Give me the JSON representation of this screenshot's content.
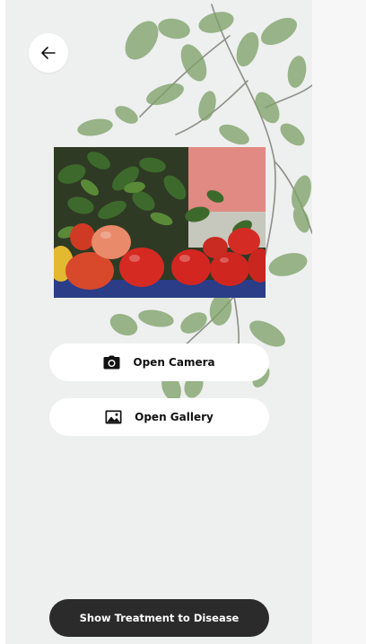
{
  "navigation": {
    "back_icon": "arrow-left-icon"
  },
  "preview": {
    "image_subject": "tomato plants with tomatoes"
  },
  "actions": {
    "camera_label": "Open Camera",
    "camera_icon": "camera-icon",
    "gallery_label": "Open Gallery",
    "gallery_icon": "image-icon"
  },
  "footer": {
    "primary_label": "Show Treatment to Disease"
  },
  "colors": {
    "background": "#eeefef",
    "button_bg": "#ffffff",
    "primary_bg": "#2b2b2b",
    "leaf": "#7fa36a",
    "tomato": "#d9322a"
  }
}
